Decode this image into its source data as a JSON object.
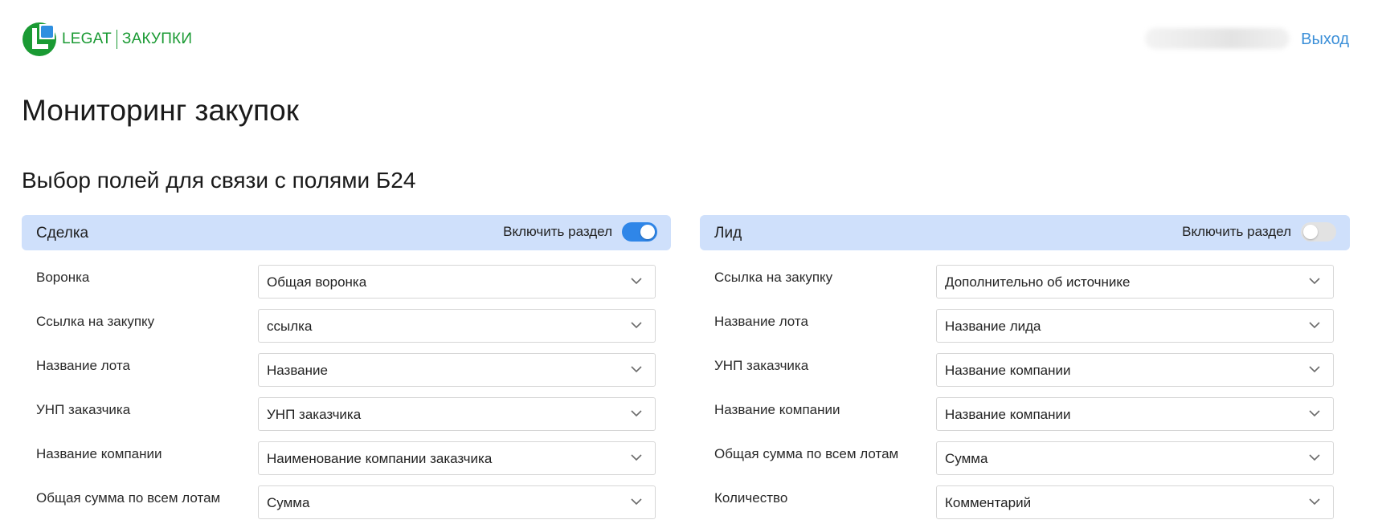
{
  "header": {
    "logo_brand": "LEGAT",
    "logo_product": "ЗАКУПКИ",
    "logout_label": "Выход",
    "colors": {
      "logo_green": "#1a9a33",
      "logo_blue": "#2f8fe0",
      "link_blue": "#3b8fd8"
    }
  },
  "page": {
    "title": "Мониторинг закупок",
    "section_title": "Выбор полей для связи с полями Б24"
  },
  "panels": {
    "deal": {
      "title": "Сделка",
      "toggle_label": "Включить раздел",
      "enabled": true,
      "rows": [
        {
          "label": "Воронка",
          "value": "Общая воронка"
        },
        {
          "label": "Ссылка на закупку",
          "value": "ссылка"
        },
        {
          "label": "Название лота",
          "value": "Название"
        },
        {
          "label": "УНП заказчика",
          "value": "УНП заказчика"
        },
        {
          "label": "Название компании",
          "value": "Наименование компании заказчика"
        },
        {
          "label": "Общая сумма по всем лотам",
          "value": "Сумма"
        }
      ]
    },
    "lead": {
      "title": "Лид",
      "toggle_label": "Включить раздел",
      "enabled": false,
      "rows": [
        {
          "label": "Ссылка на закупку",
          "value": "Дополнительно об источнике"
        },
        {
          "label": "Название лота",
          "value": "Название лида"
        },
        {
          "label": "УНП заказчика",
          "value": "Название компании"
        },
        {
          "label": "Название компании",
          "value": "Название компании"
        },
        {
          "label": "Общая сумма по всем лотам",
          "value": "Сумма"
        },
        {
          "label": "Количество",
          "value": "Комментарий"
        }
      ]
    }
  },
  "colors": {
    "panel_header_bg": "#cfe0fb",
    "toggle_on": "#2f86e8",
    "toggle_off": "#e2e2e2"
  }
}
